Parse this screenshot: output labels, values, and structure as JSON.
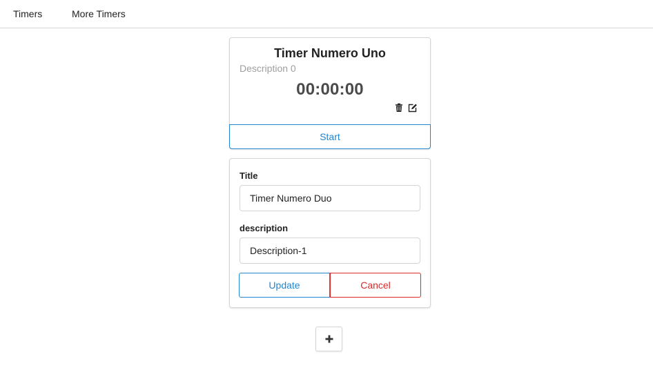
{
  "nav": {
    "items": [
      {
        "label": "Timers"
      },
      {
        "label": "More Timers"
      }
    ]
  },
  "timer": {
    "title": "Timer Numero Uno",
    "description": "Description 0",
    "elapsed": "00:00:00",
    "start_label": "Start",
    "icons": [
      "trash-icon",
      "edit-icon"
    ]
  },
  "form": {
    "title_label": "Title",
    "title_value": "Timer Numero Duo",
    "description_label": "description",
    "description_value": "Description-1",
    "update_label": "Update",
    "cancel_label": "Cancel"
  },
  "add_button": {
    "icon": "plus-icon"
  },
  "colors": {
    "primary": "#2185d0",
    "danger": "#db2828",
    "border": "#d4d4d5",
    "muted_text": "#9e9e9e"
  }
}
